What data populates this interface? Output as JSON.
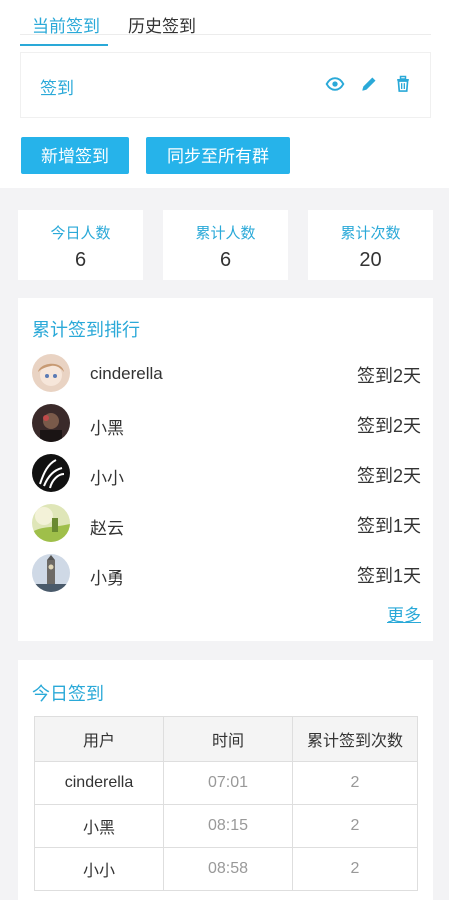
{
  "tabs": {
    "current": "当前签到",
    "history": "历史签到"
  },
  "checkin": {
    "title": "签到"
  },
  "buttons": {
    "add": "新增签到",
    "sync": "同步至所有群"
  },
  "stats": [
    {
      "label": "今日人数",
      "value": "6"
    },
    {
      "label": "累计人数",
      "value": "6"
    },
    {
      "label": "累计次数",
      "value": "20"
    }
  ],
  "ranking": {
    "title": "累计签到排行",
    "items": [
      {
        "name": "cinderella",
        "days": "签到2天"
      },
      {
        "name": "小黑",
        "days": "签到2天"
      },
      {
        "name": "小小",
        "days": "签到2天"
      },
      {
        "name": "赵云",
        "days": "签到1天"
      },
      {
        "name": "小勇",
        "days": "签到1天"
      }
    ],
    "more": "更多"
  },
  "today": {
    "title": "今日签到",
    "headers": [
      "用户",
      "时间",
      "累计签到次数"
    ],
    "rows": [
      {
        "user": "cinderella",
        "time": "07:01",
        "count": "2"
      },
      {
        "user": "小黑",
        "time": "08:15",
        "count": "2"
      },
      {
        "user": "小小",
        "time": "08:58",
        "count": "2"
      }
    ]
  },
  "colors": {
    "accent": "#2aa9d8",
    "button": "#26b3ea"
  }
}
